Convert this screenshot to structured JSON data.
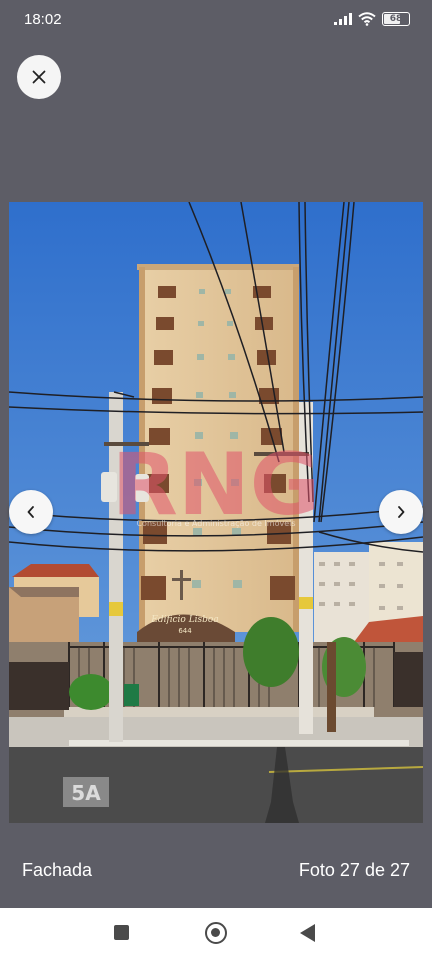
{
  "status_bar": {
    "time": "18:02",
    "battery": "68",
    "battery_level": 0.68
  },
  "viewer": {
    "caption": "Fachada",
    "counter": "Foto 27 de 27"
  },
  "photo": {
    "watermark": "RNG",
    "watermark_subtext": "Consultoria e Administração de Imóveis",
    "sign_text": "Edificio Lisboa",
    "sign_number": "644",
    "logo_text": "5A"
  },
  "icons": {
    "close": "close-icon",
    "prev": "chevron-left-icon",
    "next": "chevron-right-icon"
  }
}
